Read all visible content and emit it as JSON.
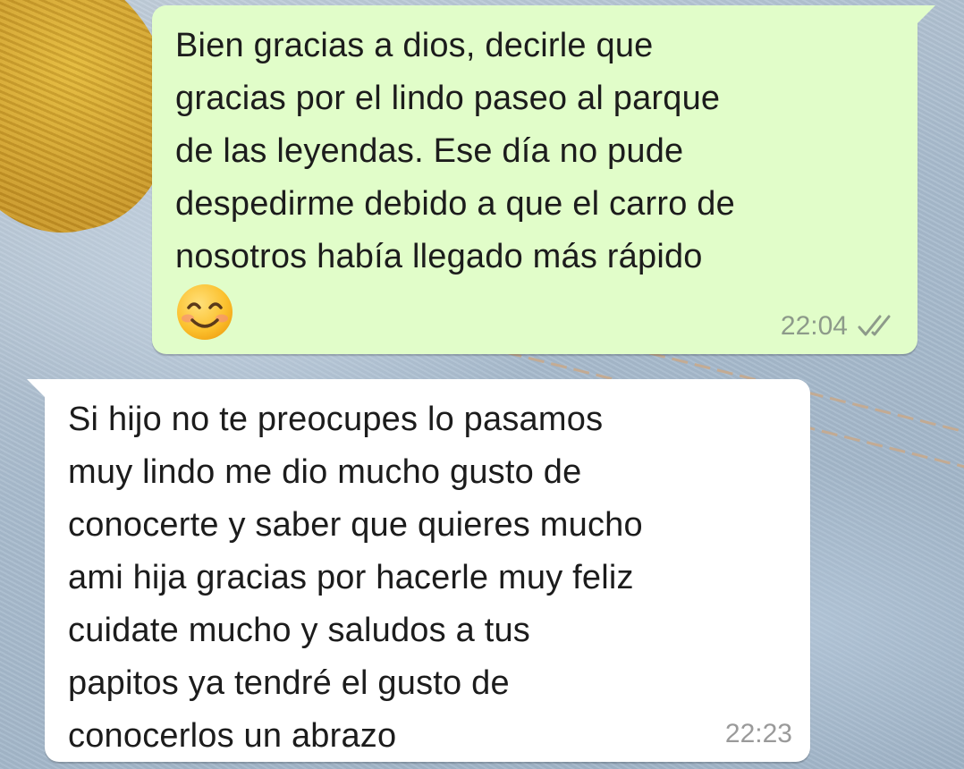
{
  "conversation": {
    "messages": [
      {
        "direction": "outgoing",
        "text": "Bien gracias a dios, decirle que\ngracias por el lindo paseo al parque\nde las leyendas. Ese día no pude\ndespedirme debido a que el carro de\nnosotros había llegado más rápido",
        "emoji": "smiling-face-with-smiling-eyes",
        "time": "22:04",
        "status": "delivered",
        "status_icon": "double-check-icon"
      },
      {
        "direction": "incoming",
        "text": "Si hijo no te preocupes lo pasamos\nmuy lindo me dio mucho gusto de\nconocerte y saber que quieres mucho\nami hija gracias por hacerle muy feliz\ncuidate mucho y saludos a tus\npapitos ya tendré el gusto de\nconocerlos un abrazo",
        "time": "22:23"
      }
    ]
  },
  "colors": {
    "outgoing_bubble": "#e1fdc9",
    "incoming_bubble": "#ffffff",
    "message_text": "#1c1c1c",
    "timestamp": "#8d9a8a",
    "emoji_face": "#fbc02d"
  }
}
